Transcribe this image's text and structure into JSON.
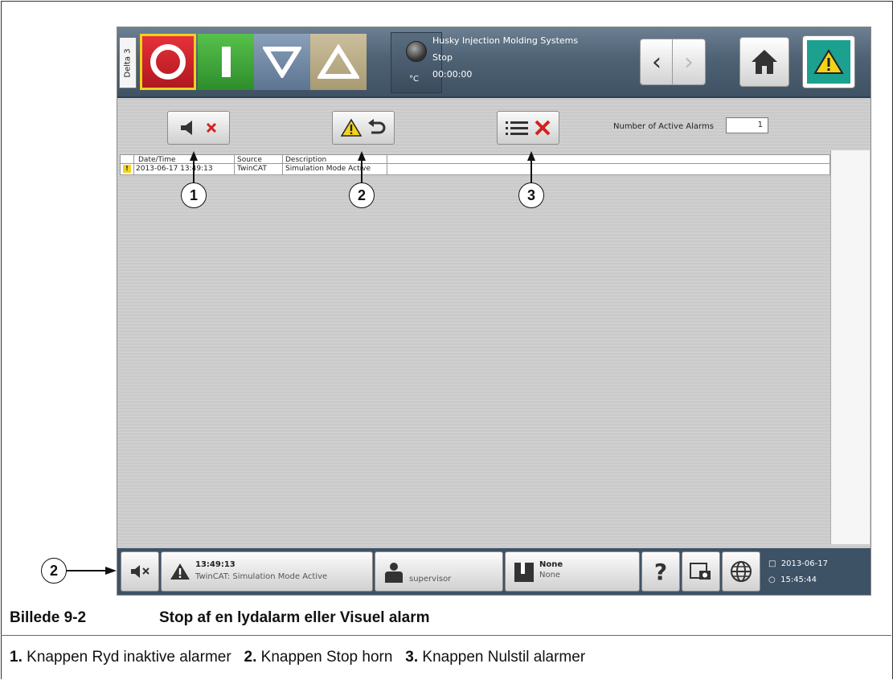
{
  "header": {
    "side_tab": "Delta 3",
    "temp_unit": "°C",
    "company": "Husky Injection Molding Systems",
    "state": "Stop",
    "timer": "00:00:00"
  },
  "toolbar": {
    "active_alarms_label": "Number of Active Alarms",
    "active_alarms_value": "1"
  },
  "alarm_table": {
    "columns": [
      "Date/Time",
      "Source",
      "Description"
    ],
    "rows": [
      {
        "datetime": "2013-06-17 13:49:13",
        "source": "TwinCAT",
        "description": "Simulation Mode Active"
      }
    ]
  },
  "footer": {
    "alarm_time": "13:49:13",
    "alarm_text": "TwinCAT: Simulation Mode Active",
    "user": "supervisor",
    "mold_line1": "None",
    "mold_line2": "None",
    "help": "?",
    "date": "2013-06-17",
    "time": "15:45:44"
  },
  "callouts": {
    "c1": "1",
    "c2": "2",
    "c3": "3",
    "c4": "2"
  },
  "caption": {
    "label": "Billede 9-2",
    "title": "Stop af en lydalarm eller Visuel alarm"
  },
  "legend": {
    "n1": "1.",
    "t1": "Knappen Ryd inaktive alarmer",
    "n2": "2.",
    "t2": "Knappen Stop horn",
    "n3": "3.",
    "t3": "Knappen Nulstil alarmer"
  },
  "colors": {
    "header": "#4f6274",
    "alarm_yellow": "#f3d21a",
    "alarm_red": "#d42020",
    "teal": "#1ca08f"
  }
}
